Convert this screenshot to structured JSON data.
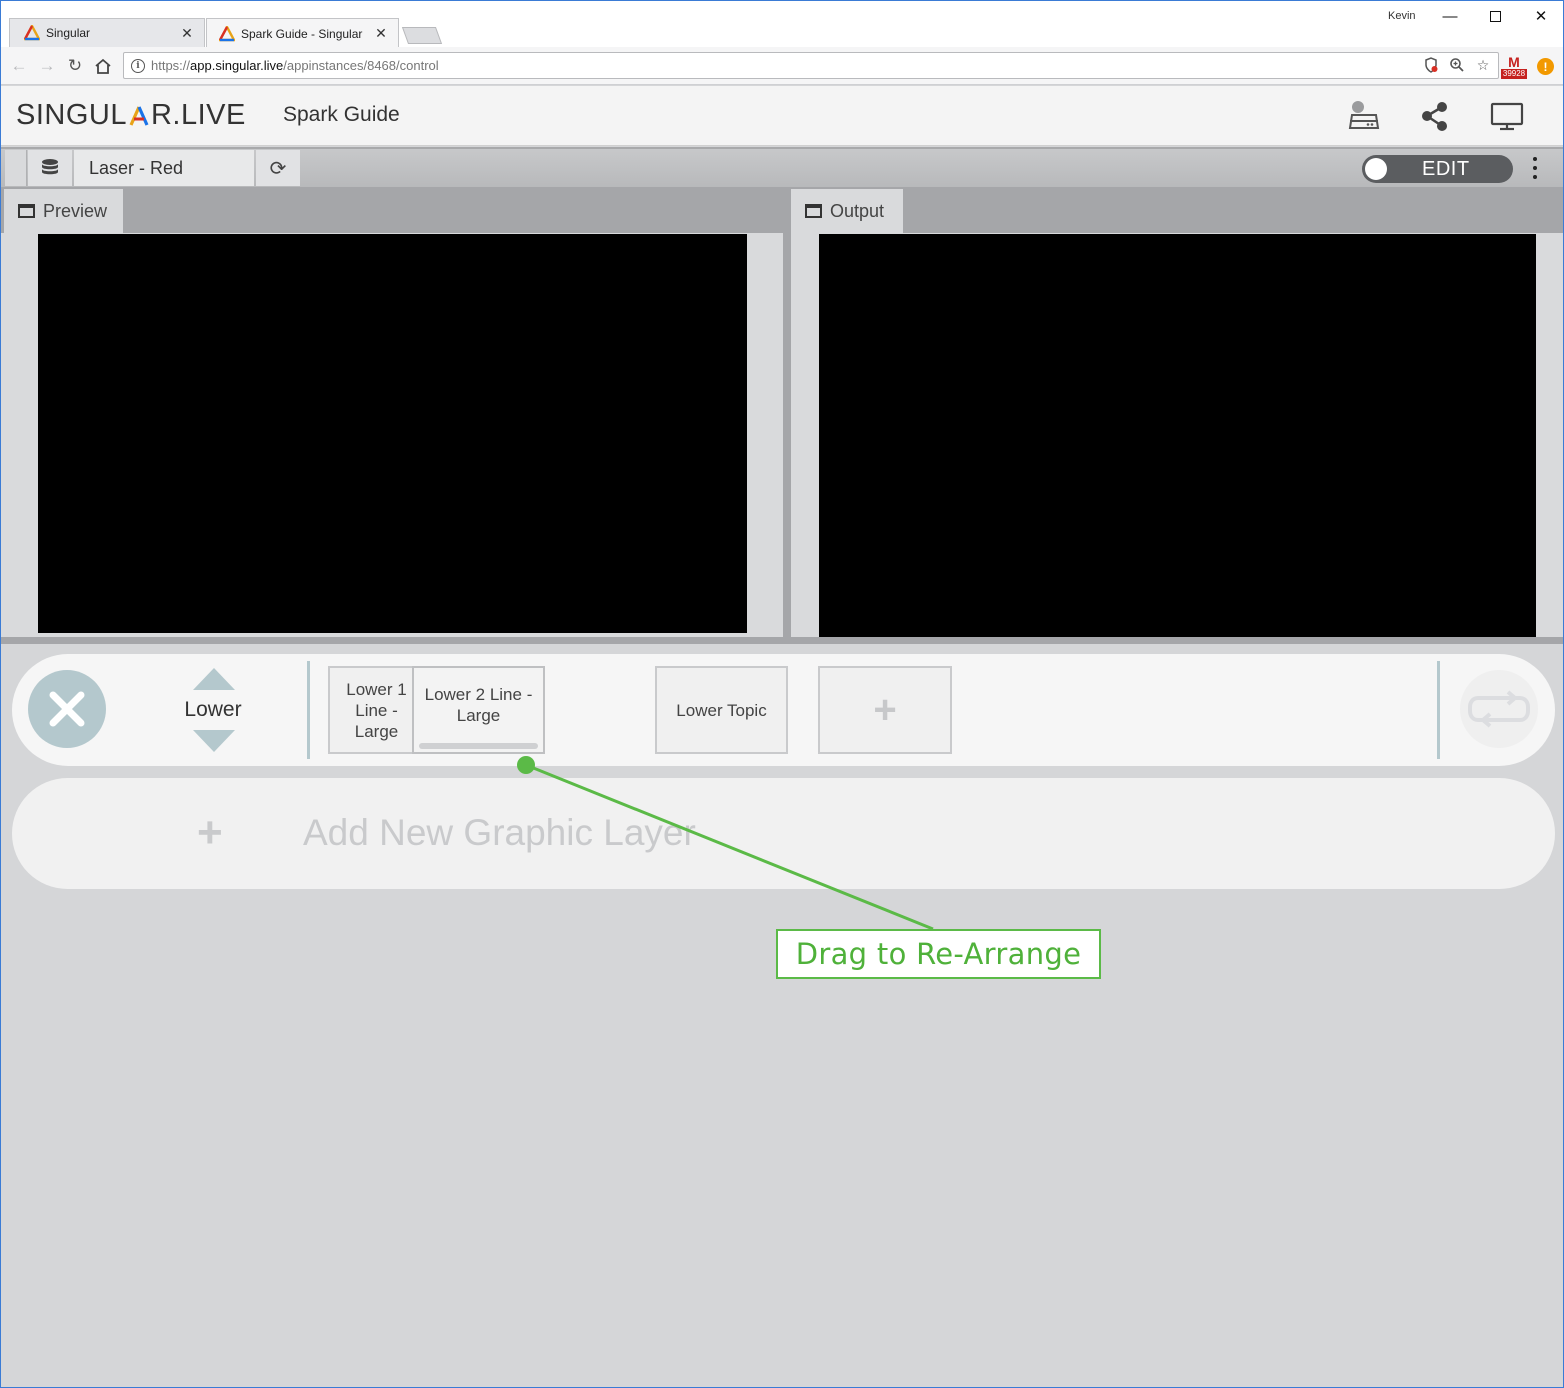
{
  "browser": {
    "tabs": [
      {
        "label": "Singular",
        "active": false
      },
      {
        "label": "Spark Guide - Singular",
        "active": true
      }
    ],
    "user_name": "Kevin",
    "url_scheme": "https://",
    "url_host": "app.singular.live",
    "url_path": "/appinstances/8468/control",
    "gmail_badge": "39928",
    "window_buttons": [
      "minimize-icon",
      "maximize-icon",
      "close-icon"
    ]
  },
  "app": {
    "logo_left": "SINGUL",
    "logo_right": "R.LIVE",
    "project_title": "Spark Guide",
    "header_icons": [
      "storage-icon",
      "share-icon",
      "monitor-icon"
    ]
  },
  "compbar": {
    "composition_name": "Laser - Red",
    "edit_label": "EDIT"
  },
  "panes": {
    "preview_label": "Preview",
    "output_label": "Output"
  },
  "layer": {
    "name": "Lower",
    "items": [
      {
        "label": "Lower 1 Line - Large"
      },
      {
        "label": "Lower 2 Line - Large"
      },
      {
        "label": "Lower Topic"
      }
    ]
  },
  "add_layer": {
    "label": "Add New Graphic Layer"
  },
  "annotation": {
    "text": "Drag to Re-Arrange",
    "color": "#5bba47"
  },
  "colors": {
    "accent_teal": "#b4c8cd",
    "edit_toggle": "#5b5d60",
    "background": "#d5d6d8"
  }
}
